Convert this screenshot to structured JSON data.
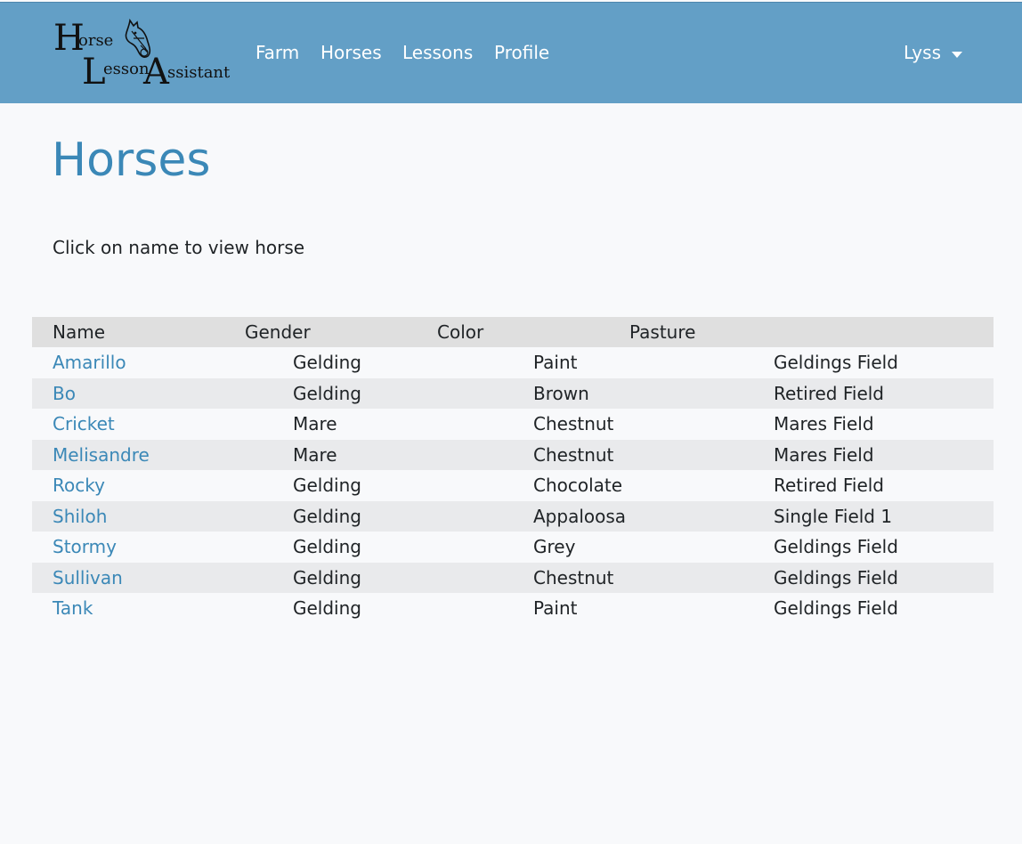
{
  "brand": {
    "line1_cap": "H",
    "line1_rest": "orse",
    "line2_cap": "L",
    "line2_rest": "esson",
    "line3_cap": "A",
    "line3_rest": "ssistant",
    "icon": "horse-head-icon"
  },
  "nav": {
    "items": [
      {
        "label": "Farm"
      },
      {
        "label": "Horses"
      },
      {
        "label": "Lessons"
      },
      {
        "label": "Profile"
      }
    ],
    "user": "Lyss",
    "user_icon": "caret-down-icon"
  },
  "page": {
    "title": "Horses",
    "hint": "Click on name to view horse"
  },
  "table": {
    "headers": [
      "Name",
      "Gender",
      "Color",
      "Pasture"
    ],
    "rows": [
      {
        "name": "Amarillo",
        "gender": "Gelding",
        "color": "Paint",
        "pasture": "Geldings Field"
      },
      {
        "name": "Bo",
        "gender": "Gelding",
        "color": "Brown",
        "pasture": "Retired Field"
      },
      {
        "name": "Cricket",
        "gender": "Mare",
        "color": "Chestnut",
        "pasture": "Mares Field"
      },
      {
        "name": "Melisandre",
        "gender": "Mare",
        "color": "Chestnut",
        "pasture": "Mares Field"
      },
      {
        "name": "Rocky",
        "gender": "Gelding",
        "color": "Chocolate",
        "pasture": "Retired Field"
      },
      {
        "name": "Shiloh",
        "gender": "Gelding",
        "color": "Appaloosa",
        "pasture": "Single Field 1"
      },
      {
        "name": "Stormy",
        "gender": "Gelding",
        "color": "Grey",
        "pasture": "Geldings Field"
      },
      {
        "name": "Sullivan",
        "gender": "Gelding",
        "color": "Chestnut",
        "pasture": "Geldings Field"
      },
      {
        "name": "Tank",
        "gender": "Gelding",
        "color": "Paint",
        "pasture": "Geldings Field"
      }
    ]
  },
  "colors": {
    "navbar": "#639fc6",
    "accent": "#3b88b7",
    "background": "#f8f9fb",
    "header_row": "#dfdfdf",
    "stripe": "#e9eaec"
  }
}
